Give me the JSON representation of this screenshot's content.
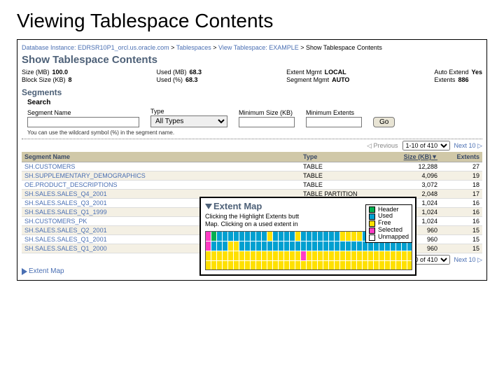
{
  "slide": {
    "title": "Viewing Tablespace Contents"
  },
  "breadcrumb": {
    "items": [
      "Database Instance: EDRSR10P1_orcl.us.oracle.com",
      "Tablespaces",
      "View Tablespace: EXAMPLE",
      "Show Tablespace Contents"
    ]
  },
  "page": {
    "title": "Show Tablespace Contents"
  },
  "stats": {
    "size_mb": {
      "label": "Size (MB)",
      "value": "100.0"
    },
    "block_size": {
      "label": "Block Size (KB)",
      "value": "8"
    },
    "used_mb": {
      "label": "Used (MB)",
      "value": "68.3"
    },
    "used_pct": {
      "label": "Used (%)",
      "value": "68.3"
    },
    "extent_mgmt": {
      "label": "Extent Mgmt",
      "value": "LOCAL"
    },
    "segment_mgmt": {
      "label": "Segment Mgmt",
      "value": "AUTO"
    },
    "auto_extend": {
      "label": "Auto Extend",
      "value": "Yes"
    },
    "extents": {
      "label": "Extents",
      "value": "886"
    }
  },
  "segments": {
    "heading": "Segments"
  },
  "search": {
    "title": "Search",
    "name": {
      "label": "Segment Name",
      "value": ""
    },
    "type": {
      "label": "Type",
      "selected": "All Types"
    },
    "min_size": {
      "label": "Minimum Size (KB)",
      "value": ""
    },
    "min_extents": {
      "label": "Minimum Extents",
      "value": ""
    },
    "go_label": "Go",
    "hint": "You can use the wildcard symbol (%) in the segment name."
  },
  "pager": {
    "previous": "◁ Previous",
    "range": "1-10 of 410",
    "next": "Next 10 ▷"
  },
  "table": {
    "columns": [
      "Segment Name",
      "Type",
      "Size (KB)▼",
      "Extents"
    ],
    "rows": [
      {
        "name": "SH.CUSTOMERS",
        "type": "TABLE",
        "size": "12,288",
        "extents": "27"
      },
      {
        "name": "SH.SUPPLEMENTARY_DEMOGRAPHICS",
        "type": "TABLE",
        "size": "4,096",
        "extents": "19"
      },
      {
        "name": "OE.PRODUCT_DESCRIPTIONS",
        "type": "TABLE",
        "size": "3,072",
        "extents": "18"
      },
      {
        "name": "SH.SALES.SALES_Q4_2001",
        "type": "TABLE PARTITION",
        "size": "2,048",
        "extents": "17"
      },
      {
        "name": "SH.SALES.SALES_Q3_2001",
        "type": "",
        "size": "1,024",
        "extents": "16"
      },
      {
        "name": "SH.SALES.SALES_Q1_1999",
        "type": "",
        "size": "1,024",
        "extents": "16"
      },
      {
        "name": "SH.CUSTOMERS_PK",
        "type": "",
        "size": "1,024",
        "extents": "16"
      },
      {
        "name": "SH.SALES.SALES_Q2_2001",
        "type": "",
        "size": "960",
        "extents": "15"
      },
      {
        "name": "SH.SALES.SALES_Q1_2001",
        "type": "",
        "size": "960",
        "extents": "15"
      },
      {
        "name": "SH.SALES.SALES_Q1_2000",
        "type": "",
        "size": "960",
        "extents": "15"
      }
    ]
  },
  "extent_map": {
    "link_label": "Extent Map",
    "title": "Extent Map",
    "desc_line1": "Clicking the Highlight Extents butt",
    "desc_line2": "Map. Clicking on a used extent in",
    "legend": [
      "Header",
      "Used",
      "Free",
      "Selected",
      "Unmapped"
    ],
    "colors": {
      "header": "#00b050",
      "used": "#00a0d0",
      "free": "#ffe000",
      "selected": "#ff3cc4",
      "unmapped": "#ffffff"
    }
  },
  "chart_data": {
    "type": "heatmap",
    "title": "Extent Map",
    "rows": 4,
    "cols": 37,
    "cell_colors_by_row": [
      [
        "selected",
        "header",
        "used",
        "used",
        "used",
        "used",
        "used",
        "used",
        "used",
        "used",
        "used",
        "free",
        "used",
        "used",
        "used",
        "used",
        "free",
        "used",
        "used",
        "used",
        "used",
        "used",
        "used",
        "used",
        "free",
        "free",
        "free",
        "free",
        "used",
        "used",
        "used",
        "used",
        "used",
        "used",
        "used",
        "used",
        "used"
      ],
      [
        "selected",
        "used",
        "used",
        "used",
        "free",
        "free",
        "used",
        "used",
        "used",
        "used",
        "used",
        "used",
        "used",
        "used",
        "used",
        "used",
        "used",
        "used",
        "used",
        "used",
        "used",
        "used",
        "used",
        "used",
        "used",
        "used",
        "used",
        "used",
        "used",
        "used",
        "used",
        "used",
        "used",
        "used",
        "used",
        "used",
        "used"
      ],
      [
        "free",
        "free",
        "free",
        "free",
        "free",
        "free",
        "free",
        "free",
        "free",
        "free",
        "free",
        "free",
        "free",
        "free",
        "free",
        "free",
        "free",
        "selected",
        "free",
        "free",
        "free",
        "free",
        "free",
        "free",
        "free",
        "free",
        "free",
        "free",
        "free",
        "free",
        "free",
        "free",
        "free",
        "free",
        "free",
        "free",
        "free"
      ],
      [
        "free",
        "free",
        "free",
        "free",
        "free",
        "free",
        "free",
        "free",
        "free",
        "free",
        "free",
        "free",
        "free",
        "free",
        "free",
        "free",
        "free",
        "free",
        "free",
        "free",
        "free",
        "free",
        "free",
        "free",
        "free",
        "free",
        "free",
        "free",
        "free",
        "free",
        "free",
        "free",
        "free",
        "free",
        "free",
        "free",
        "free"
      ]
    ]
  }
}
